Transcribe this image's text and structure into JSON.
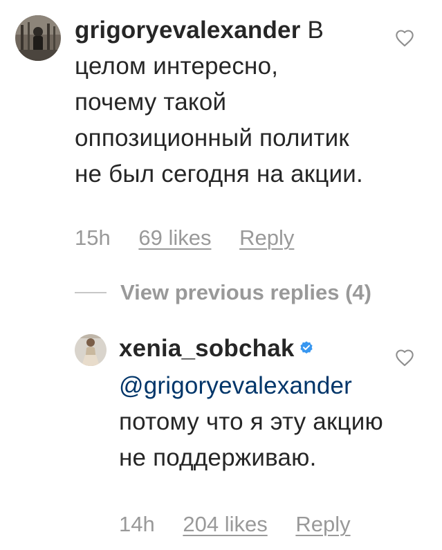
{
  "comment1": {
    "username": "grigoryevalexander",
    "text": " В целом интересно, почему такой оппозиционный политик не был сегодня на акции.",
    "time": "15h",
    "likes": "69 likes",
    "reply": "Reply",
    "like_icon": "heart-outline-icon"
  },
  "view_previous": {
    "label": "View previous replies (4)"
  },
  "comment2": {
    "username": "xenia_sobchak",
    "verified_icon": "verified-badge-icon",
    "mention": "@grigoryevalexander",
    "text": " потому что я эту акцию не поддерживаю.",
    "time": "14h",
    "likes": "204 likes",
    "reply": "Reply",
    "like_icon": "heart-outline-icon"
  },
  "colors": {
    "text": "#262626",
    "secondary": "#999999",
    "mention": "#003569",
    "verified": "#3897f0"
  }
}
